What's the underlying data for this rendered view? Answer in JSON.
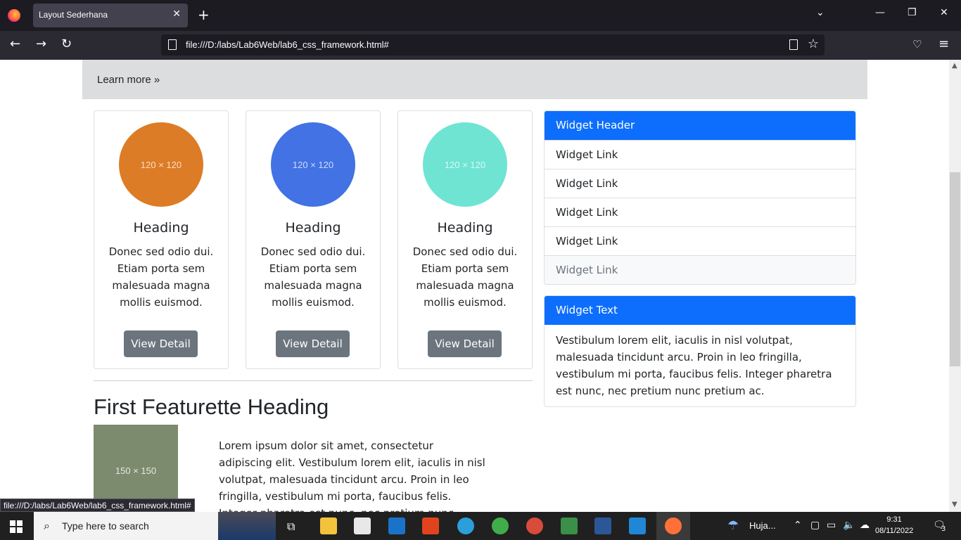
{
  "browser": {
    "tab_title": "Layout Sederhana",
    "url": "file:///D:/labs/Lab6Web/lab6_css_framework.html#",
    "status_url": "file:///D:/labs/Lab6Web/lab6_css_framework.html#"
  },
  "jumbotron": {
    "learn_more": "Learn more »"
  },
  "cards": [
    {
      "image_label": "120 × 120",
      "color": "#dd7c26",
      "heading": "Heading",
      "text": "Donec sed odio dui. Etiam porta sem malesuada magna mollis euismod.",
      "button": "View Detail"
    },
    {
      "image_label": "120 × 120",
      "color": "#4272e4",
      "heading": "Heading",
      "text": "Donec sed odio dui. Etiam porta sem malesuada magna mollis euismod.",
      "button": "View Detail"
    },
    {
      "image_label": "120 × 120",
      "color": "#6fe4d3",
      "heading": "Heading",
      "text": "Donec sed odio dui. Etiam porta sem malesuada magna mollis euismod.",
      "button": "View Detail"
    }
  ],
  "featurette": {
    "heading": "First Featurette Heading",
    "image_label": "150 × 150",
    "text": "Lorem ipsum dolor sit amet, consectetur adipiscing elit. Vestibulum lorem elit, iaculis in nisl volutpat, malesuada tincidunt arcu. Proin in leo fringilla, vestibulum mi porta, faucibus felis. Integer pharetra est nunc, nec pretium nunc pretium ac."
  },
  "widget_links": {
    "header": "Widget Header",
    "links": [
      "Widget Link",
      "Widget Link",
      "Widget Link",
      "Widget Link",
      "Widget Link"
    ]
  },
  "widget_text": {
    "header": "Widget Text",
    "body": "Vestibulum lorem elit, iaculis in nisl volutpat, malesuada tincidunt arcu. Proin in leo fringilla, vestibulum mi porta, faucibus felis. Integer pharetra est nunc, nec pretium nunc pretium ac."
  },
  "taskbar": {
    "search_placeholder": "Type here to search",
    "weather": "Huja...",
    "time": "9:31",
    "date": "08/11/2022",
    "notifications": "3"
  },
  "colors": {
    "accent": "#0d6efd",
    "button": "#6c757d"
  }
}
